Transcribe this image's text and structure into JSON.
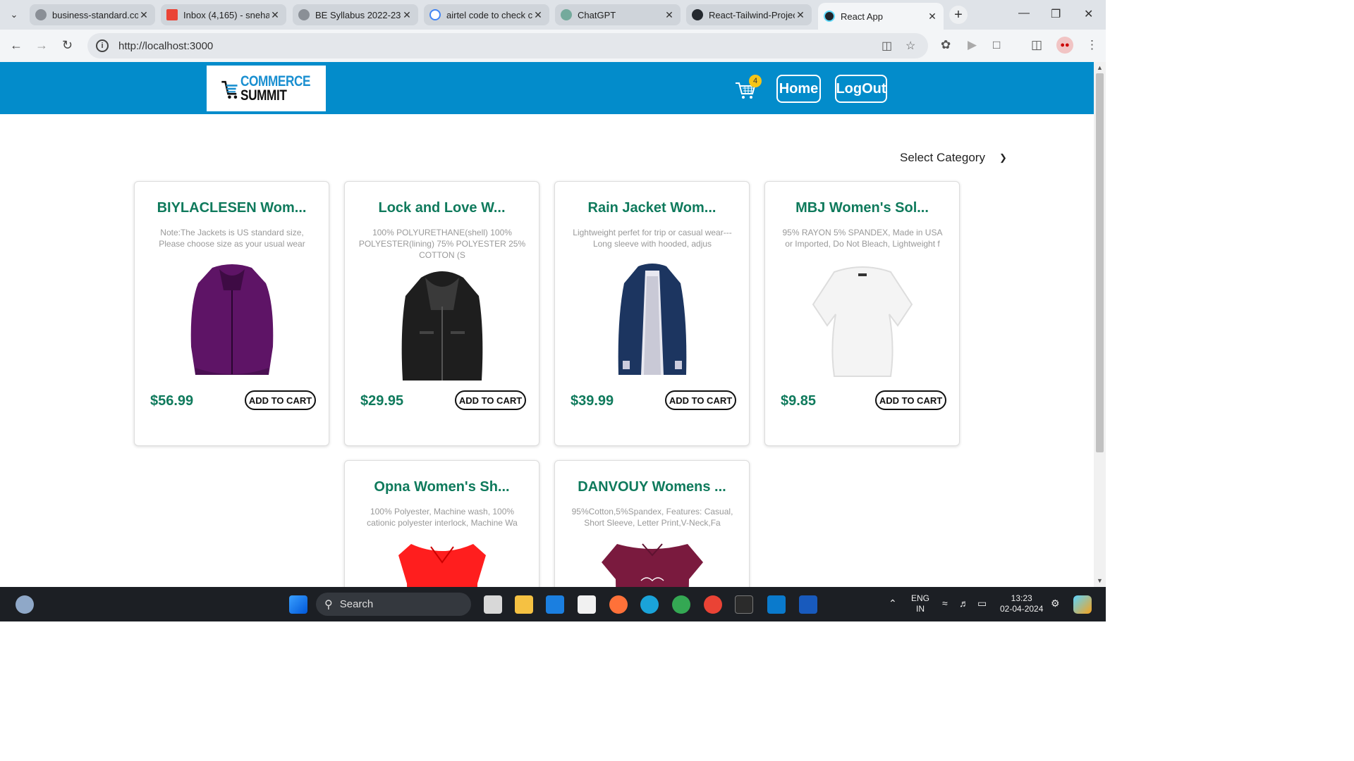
{
  "browser": {
    "tabs": [
      {
        "title": "business-standard.co",
        "color": "#8a8f96"
      },
      {
        "title": "Inbox (4,165) - sneha",
        "color": "#ea4335"
      },
      {
        "title": "BE Syllabus 2022-23.",
        "color": "#8a8f96"
      },
      {
        "title": "airtel code to check c",
        "color": "#4285f4"
      },
      {
        "title": "ChatGPT",
        "color": "#74aa9c"
      },
      {
        "title": "React-Tailwind-Projec",
        "color": "#24292f"
      },
      {
        "title": "React App",
        "color": "#61dafb"
      }
    ],
    "url": "http://localhost:3000"
  },
  "header": {
    "logo_line1": "COMMERCE",
    "logo_line2": "SUMMIT",
    "cart_count": "4",
    "home_label": "Home",
    "logout_label": "LogOut"
  },
  "filter": {
    "label": "Select Category"
  },
  "products": [
    {
      "title": "BIYLACLESEN Wom...",
      "desc": "Note:The Jackets is US standard size, Please choose size as your usual wear",
      "price": "$56.99",
      "button": "ADD TO CART"
    },
    {
      "title": "Lock and Love W...",
      "desc": "100% POLYURETHANE(shell) 100% POLYESTER(lining) 75% POLYESTER 25% COTTON (S",
      "price": "$29.95",
      "button": "ADD TO CART"
    },
    {
      "title": "Rain Jacket Wom...",
      "desc": "Lightweight perfet for trip or casual wear---Long sleeve with hooded, adjus",
      "price": "$39.99",
      "button": "ADD TO CART"
    },
    {
      "title": "MBJ Women's Sol...",
      "desc": "95% RAYON 5% SPANDEX, Made in USA or Imported, Do Not Bleach, Lightweight f",
      "price": "$9.85",
      "button": "ADD TO CART"
    },
    {
      "title": "Opna Women's Sh...",
      "desc": "100% Polyester, Machine wash, 100% cationic polyester interlock, Machine Wa",
      "price": "",
      "button": ""
    },
    {
      "title": "DANVOUY Womens ...",
      "desc": "95%Cotton,5%Spandex, Features: Casual, Short Sleeve, Letter Print,V-Neck,Fa",
      "price": "",
      "button": ""
    }
  ],
  "taskbar": {
    "search_label": "Search",
    "lang1": "ENG",
    "lang2": "IN",
    "time": "13:23",
    "date": "02-04-2024"
  }
}
